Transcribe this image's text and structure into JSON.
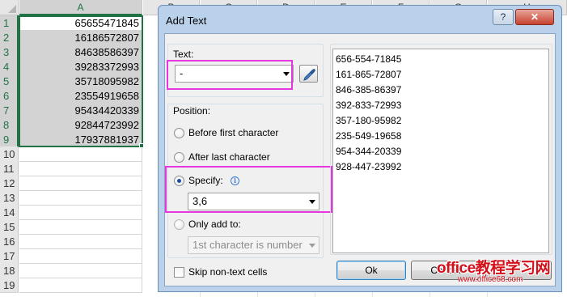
{
  "sheet": {
    "columns": [
      "A",
      "B",
      "C",
      "D",
      "E",
      "F",
      "G",
      "H"
    ],
    "rows": [
      "1",
      "2",
      "3",
      "4",
      "5",
      "6",
      "7",
      "8",
      "9",
      "10",
      "11",
      "12",
      "13",
      "14",
      "15",
      "16",
      "17",
      "18",
      "19"
    ],
    "values": [
      "65655471845",
      "16186572807",
      "84638586397",
      "39283372993",
      "35718095982",
      "23554919658",
      "95434420339",
      "92844723992",
      "17937881937"
    ]
  },
  "dialog": {
    "title": "Add Text",
    "help_label": "?",
    "close_label": "✕",
    "text_label": "Text:",
    "text_value": "-",
    "position_label": "Position:",
    "options": {
      "before_first": "Before first character",
      "after_last": "After last character",
      "specify": "Specify:",
      "only_add_to": "Only add to:"
    },
    "specify_value": "3,6",
    "only_add_to_value": "1st character is number",
    "skip_label": "Skip non-text cells",
    "ok_label": "Ok",
    "cancel_label": "Cancel",
    "preview": [
      "656-554-71845",
      "161-865-72807",
      "846-385-86397",
      "392-833-72993",
      "357-180-95982",
      "235-549-19658",
      "954-344-20339",
      "928-447-23992"
    ]
  },
  "watermark": {
    "main": "office教程学习网",
    "url": "www.office68.com"
  },
  "colors": {
    "selection_green": "#217346",
    "highlight_magenta": "#e536e0",
    "dialog_frame": "#b9d1ea"
  }
}
